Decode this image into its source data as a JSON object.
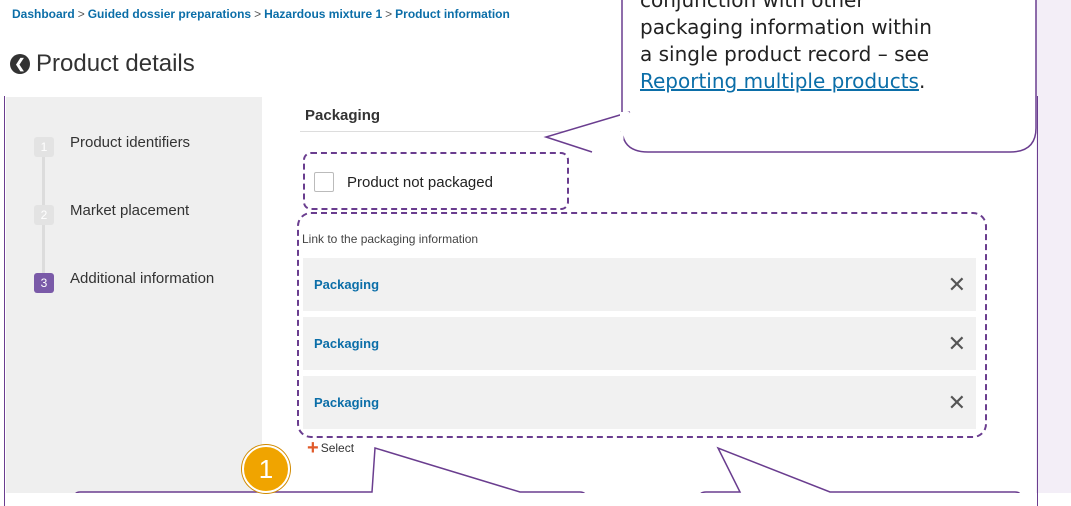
{
  "breadcrumb": {
    "items": [
      "Dashboard",
      "Guided dossier preparations",
      "Hazardous mixture 1",
      "Product information"
    ],
    "separator": ">"
  },
  "page": {
    "title": "Product details",
    "back_icon": "arrow-left-icon"
  },
  "steps": [
    {
      "number": "1",
      "label": "Product identifiers"
    },
    {
      "number": "2",
      "label": "Market placement"
    },
    {
      "number": "3",
      "label": "Additional information"
    }
  ],
  "packaging": {
    "section_title": "Packaging",
    "not_packaged_label": "Product not packaged",
    "link_label": "Link to the packaging information",
    "items": [
      {
        "label": "Packaging"
      },
      {
        "label": "Packaging"
      },
      {
        "label": "Packaging"
      }
    ],
    "select_label": "Select"
  },
  "callout": {
    "line1": "conjunction with other",
    "line2": "packaging information within",
    "line3": "a single product record – see",
    "link": "Reporting multiple products",
    "period": "."
  },
  "badge": {
    "number": "1"
  },
  "colors": {
    "accent": "#6a3d8f",
    "link": "#0b6ea8",
    "badge": "#f0a400"
  }
}
